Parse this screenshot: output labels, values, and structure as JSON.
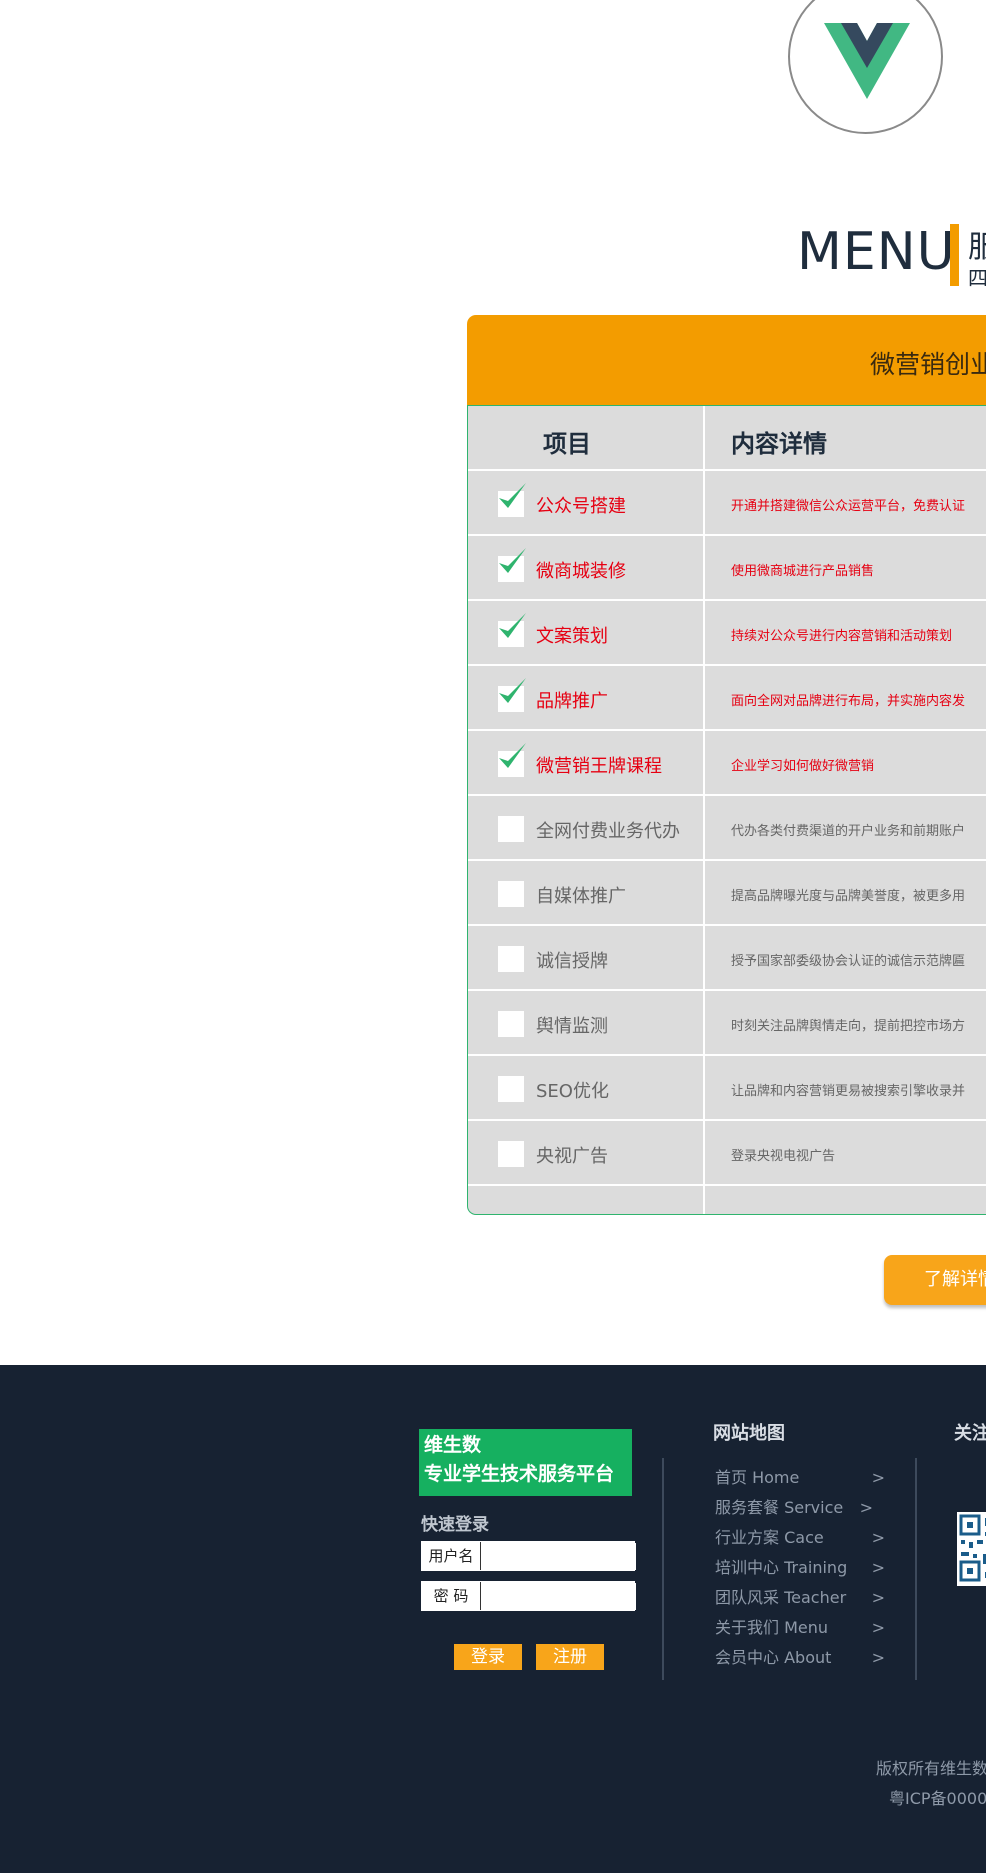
{
  "logo": {
    "icon": "vue-logo-icon"
  },
  "heading": {
    "title": "MENU",
    "subtitle_1": "服",
    "subtitle_2": "四"
  },
  "package": {
    "banner": "微营销创业",
    "columns": {
      "item": "项目",
      "detail": "内容详情"
    },
    "rows": [
      {
        "label": "公众号搭建",
        "detail": "开通并搭建微信公众运营平台，免费认证",
        "checked": true
      },
      {
        "label": "微商城装修",
        "detail": "使用微商城进行产品销售",
        "checked": true
      },
      {
        "label": "文案策划",
        "detail": "持续对公众号进行内容营销和活动策划",
        "checked": true
      },
      {
        "label": "品牌推广",
        "detail": "面向全网对品牌进行布局，并实施内容发",
        "checked": true
      },
      {
        "label": "微营销王牌课程",
        "detail": "企业学习如何做好微营销",
        "checked": true
      },
      {
        "label": "全网付费业务代办",
        "detail": "代办各类付费渠道的开户业务和前期账户",
        "checked": false
      },
      {
        "label": "自媒体推广",
        "detail": "提高品牌曝光度与品牌美誉度，被更多用",
        "checked": false
      },
      {
        "label": "诚信授牌",
        "detail": "授予国家部委级协会认证的诚信示范牌匾",
        "checked": false
      },
      {
        "label": "舆情监测",
        "detail": "时刻关注品牌舆情走向，提前把控市场方",
        "checked": false
      },
      {
        "label": "SEO优化",
        "detail": "让品牌和内容营销更易被搜索引擎收录并",
        "checked": false
      },
      {
        "label": "央视广告",
        "detail": "登录央视电视广告",
        "checked": false
      }
    ],
    "more_button": "了解详情"
  },
  "footer": {
    "brand_line1": "维生数",
    "brand_line2": "专业学生技术服务平台",
    "login": {
      "title": "快速登录",
      "username_label": "用户名",
      "username_value": "",
      "password_label": "密  码",
      "password_value": "",
      "login_button": "登录",
      "register_button": "注册"
    },
    "sitemap": {
      "title": "网站地图",
      "items": [
        {
          "label": "首页  Home",
          "arrow": ">"
        },
        {
          "label": "服务套餐  Service",
          "arrow": ">"
        },
        {
          "label": "行业方案  Cace",
          "arrow": ">"
        },
        {
          "label": "培训中心  Training",
          "arrow": ">"
        },
        {
          "label": "团队风采  Teacher",
          "arrow": ">"
        },
        {
          "label": "关于我们  Menu",
          "arrow": ">"
        },
        {
          "label": "会员中心  About",
          "arrow": ">"
        }
      ]
    },
    "follow_title": "关注",
    "copyright": "版权所有维生数",
    "icp": "粤ICP备0000"
  },
  "colors": {
    "accent": "#f39c00",
    "brand_green": "#16b060",
    "check_green": "#2fb46e",
    "highlight_red": "#e60012",
    "footer_bg": "#172232"
  }
}
